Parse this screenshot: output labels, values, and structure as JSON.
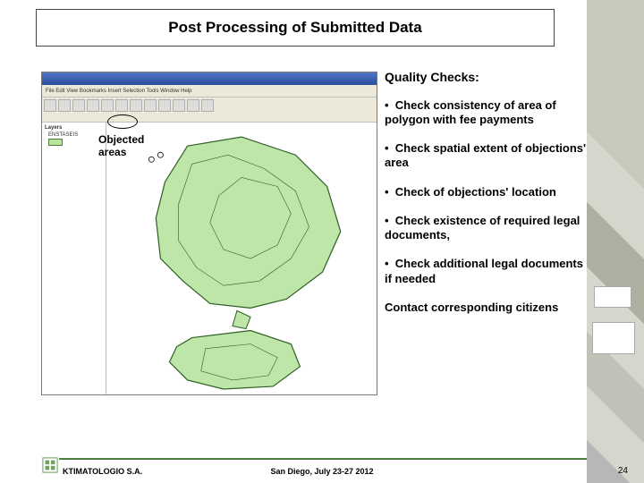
{
  "title": "Post Processing of Submitted Data",
  "gis": {
    "menu_text": "File  Edit  View  Bookmarks  Insert  Selection  Tools  Window  Help",
    "toc_header": "Layers",
    "toc_item": "ENSTASEIS"
  },
  "callout": {
    "line1": "Objected",
    "line2": "areas"
  },
  "right": {
    "heading": "Quality Checks:",
    "bullets": [
      "Check consistency of area of polygon with fee payments",
      "Check spatial extent of objections' area",
      "Check of objections' location",
      "Check existence of required legal documents,",
      "Check additional legal documents if needed"
    ],
    "closing": "Contact corresponding citizens"
  },
  "footer": {
    "org": "KTIMATOLOGIO S.A.",
    "venue": "San Diego, July 23-27 2012",
    "page": "24"
  }
}
